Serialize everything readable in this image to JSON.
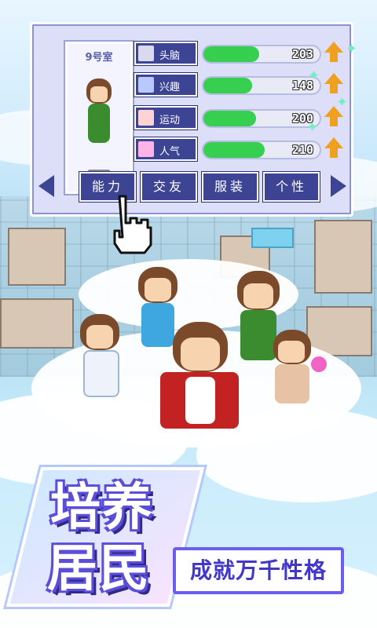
{
  "panel": {
    "room_label": "9号室",
    "stats": [
      {
        "name": "头脑",
        "value": "203",
        "fill_fraction": 0.48,
        "icon": "brain-icon",
        "icon_color": "#d9d9f0"
      },
      {
        "name": "兴趣",
        "value": "148",
        "fill_fraction": 0.42,
        "icon": "interest-icon",
        "icon_color": "#b9c8ff"
      },
      {
        "name": "运动",
        "value": "200",
        "fill_fraction": 0.45,
        "icon": "sport-icon",
        "icon_color": "#ffd3d3"
      },
      {
        "name": "人气",
        "value": "210",
        "fill_fraction": 0.53,
        "icon": "popularity-icon",
        "icon_color": "#ffb3e6"
      }
    ],
    "tabs": [
      "能力",
      "交友",
      "服装",
      "个性"
    ]
  },
  "banner": {
    "line1": "培养",
    "line2": "居民",
    "slogan": "成就万千性格"
  },
  "colors": {
    "panel_blue": "#3d4494",
    "bar_green": "#36cf4f",
    "up_arrow": "#f0a020",
    "banner_purple": "#5d4ed9"
  }
}
